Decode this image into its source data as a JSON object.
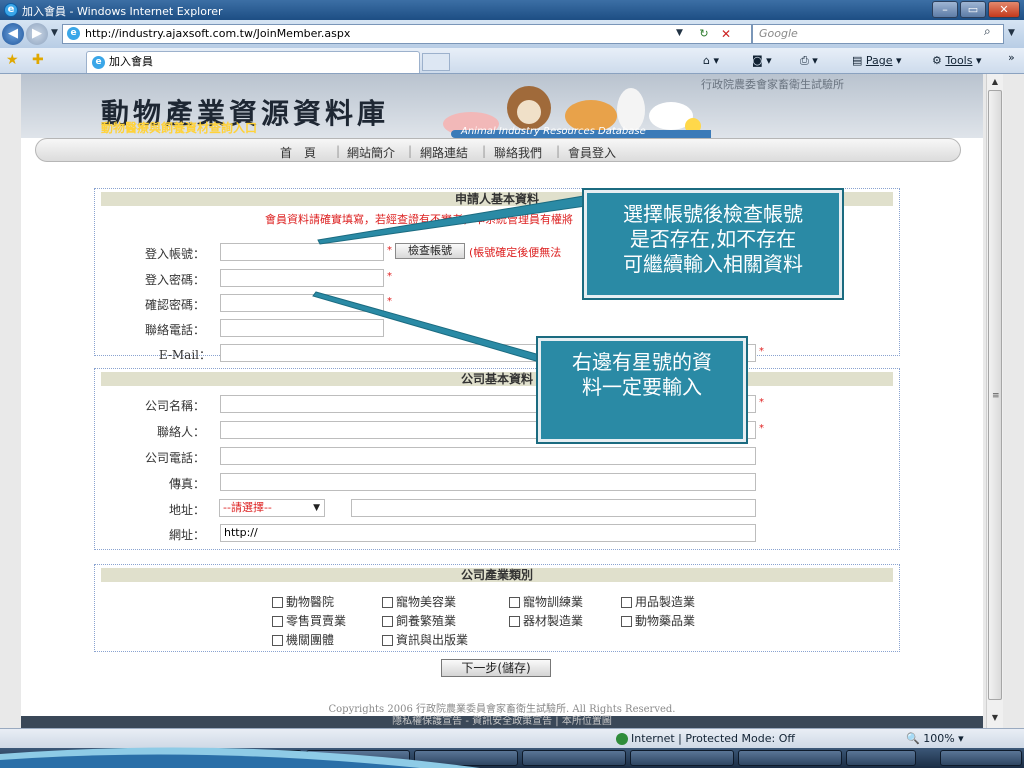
{
  "window": {
    "title": "加入會員 - Windows Internet Explorer"
  },
  "address": {
    "url": "http://industry.ajaxsoft.com.tw/JoinMember.aspx",
    "search_placeholder": "Google"
  },
  "tab": {
    "title": "加入會員"
  },
  "commands": {
    "page": "Page",
    "tools": "Tools"
  },
  "site": {
    "agency": "行政院農委會家畜衛生試驗所",
    "title": "動物產業資源資料庫",
    "subtitle": "動物醫療與飼養資材查詢入口",
    "db_label": "Animal Industry Resources Database"
  },
  "nav": [
    "首　頁",
    "網站簡介",
    "網路連結",
    "聯絡我們",
    "會員登入"
  ],
  "applicant": {
    "heading": "申請人基本資料",
    "notice": "會員資料請確實填寫，若經查證有不實者，本系統管理員有權將",
    "fields": {
      "account": "登入帳號：",
      "password": "登入密碼：",
      "confirm": "確認密碼：",
      "phone": "聯絡電話：",
      "email": "E-Mail："
    },
    "check_button": "檢查帳號",
    "check_note": "(帳號確定後便無法"
  },
  "company": {
    "heading": "公司基本資料",
    "fields": {
      "name": "公司名稱：",
      "contact": "聯絡人：",
      "phone": "公司電話：",
      "fax": "傳真：",
      "address": "地址：",
      "website": "網址："
    },
    "address_select": "--請選擇--",
    "website_value": "http://"
  },
  "industry": {
    "heading": "公司產業類別",
    "options": [
      "動物醫院",
      "寵物美容業",
      "寵物訓練業",
      "用品製造業",
      "零售買賣業",
      "飼養繁殖業",
      "器材製造業",
      "動物藥品業",
      "機關團體",
      "資訊與出版業"
    ]
  },
  "next_button": "下一步(儲存)",
  "copyright": "Copyrights 2006 行政院農業委員會家畜衛生試驗所. All Rights Reserved.",
  "footer_links": "隱私權保護宣告 - 資訊安全政策宣告 | 本所位置圖",
  "callouts": {
    "first": [
      "選擇帳號後檢查帳號",
      "是否存在,如不存在",
      "可繼續輸入相關資料"
    ],
    "second": [
      "右邊有星號的資",
      "料一定要輸入"
    ]
  },
  "status": {
    "zone": "Internet | Protected Mode: Off",
    "zoom": "100%"
  }
}
